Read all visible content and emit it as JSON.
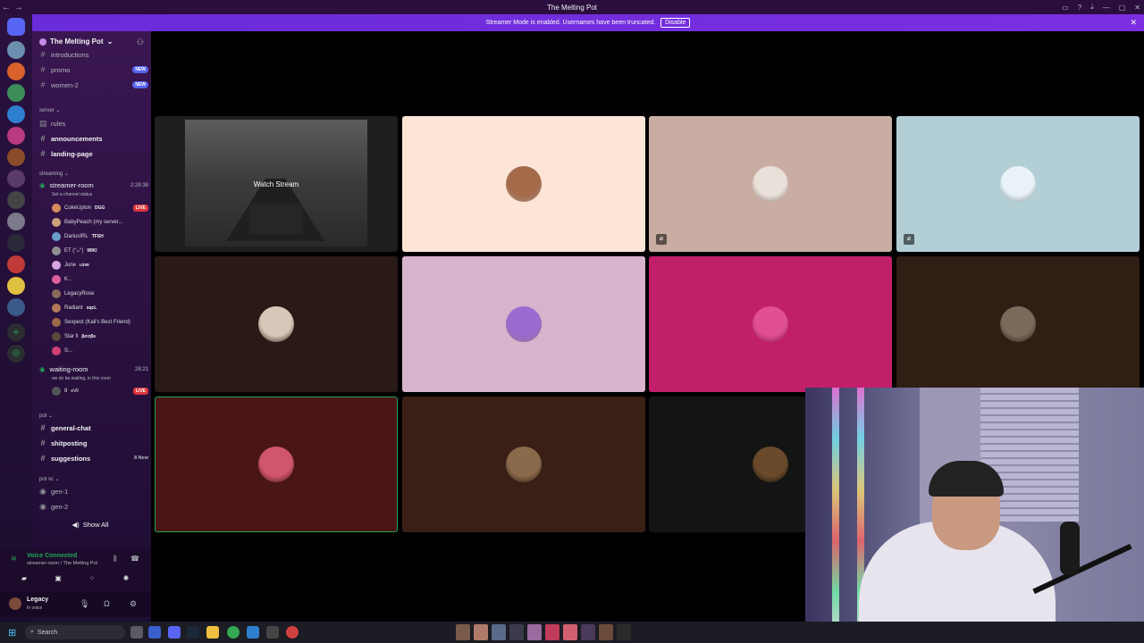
{
  "titlebar": {
    "title": "The Melting Pot",
    "back": "←",
    "forward": "→"
  },
  "banner": {
    "text": "Streamer Mode is enabled. Usernames have been truncated.",
    "disable_label": "Disable"
  },
  "server": {
    "name": "The Melting Pot"
  },
  "channels_top": [
    {
      "name": "introductions",
      "badge": ""
    },
    {
      "name": "promo",
      "badge": "NEW"
    },
    {
      "name": "women-2",
      "badge": "NEW"
    }
  ],
  "categories": {
    "server": "server",
    "streaming": "streaming",
    "pot": "pot",
    "pot_vc": "pot vc"
  },
  "server_channels": [
    {
      "name": "rules",
      "bold": false
    },
    {
      "name": "announcements",
      "bold": true
    },
    {
      "name": "landing-page",
      "bold": true
    }
  ],
  "streamer_room": {
    "name": "streamer-room",
    "time": "2:29:38",
    "status": "Set a channel status",
    "users": [
      {
        "name": "CokeUpton",
        "tag": "DGG",
        "live": "LIVE",
        "color": "#d98a5a"
      },
      {
        "name": "BabyPeach (my server...",
        "tag": "",
        "live": "",
        "color": "#c9a37a"
      },
      {
        "name": "DariusIRL",
        "tag": "TFSH",
        "live": "",
        "color": "#6aa0c9"
      },
      {
        "name": "ET (°ᴗ°)",
        "tag": "WIKI",
        "live": "",
        "color": "#8f8f8f"
      },
      {
        "name": "June",
        "tag": "ʟᴏᴠᴇ",
        "live": "",
        "color": "#d6a6e6"
      },
      {
        "name": "K...",
        "tag": "",
        "live": "",
        "color": "#e05fa0"
      },
      {
        "name": "LegacyRose",
        "tag": "",
        "live": "",
        "color": "#8a6a5a"
      },
      {
        "name": "Radiant",
        "tag": "sqcL",
        "live": "",
        "color": "#b07a5a"
      },
      {
        "name": "Sexpest (Kali's Best Friend)",
        "tag": "",
        "live": "",
        "color": "#9a6a4a"
      },
      {
        "name": "Star ll",
        "tag": "βσσβs",
        "live": "",
        "color": "#5a4a3a"
      },
      {
        "name": "S...",
        "tag": "",
        "live": "",
        "color": "#d04070"
      }
    ]
  },
  "waiting_room": {
    "name": "waiting-room",
    "time": "28:21",
    "status": "we do be waiting, in this room",
    "user": {
      "name": "8",
      "tag": "eVil",
      "live": "LIVE",
      "color": "#555"
    }
  },
  "pot_channels": [
    {
      "name": "general-chat",
      "count": ""
    },
    {
      "name": "shitposting",
      "count": ""
    },
    {
      "name": "suggestions",
      "count": "8 New"
    }
  ],
  "potvc_channels": [
    {
      "name": "gen-1"
    },
    {
      "name": "gen-2"
    }
  ],
  "show_all": "Show All",
  "voice": {
    "title": "Voice Connected",
    "sub": "streamer-room / The Melting Pot"
  },
  "user": {
    "name": "Legacy",
    "status": "In voice"
  },
  "stream_tile": {
    "label": "Watch Stream"
  },
  "tiles": [
    {
      "bg": "#fce5d6",
      "avatar": "#a46a4a"
    },
    {
      "bg": "#c9ada3",
      "avatar": "#e9e0d9"
    },
    {
      "bg": "#b2cfd6",
      "avatar": "#e9f2f6"
    },
    {
      "bg": "#2a1a17",
      "avatar": "#d8c7b8"
    },
    {
      "bg": "#d7b3cc",
      "avatar": "#9b6bd0"
    },
    {
      "bg": "#c21f6a",
      "avatar": "#e04f90"
    },
    {
      "bg": "#301e14",
      "avatar": "#7a6a5a"
    },
    {
      "bg": "#4a1515",
      "avatar": "#d0566b"
    },
    {
      "bg": "#3a1f17",
      "avatar": "#8a6a4a"
    },
    {
      "bg": "#141414",
      "avatar": "#6a4a2a"
    }
  ],
  "taskbar": {
    "search": "Search"
  }
}
